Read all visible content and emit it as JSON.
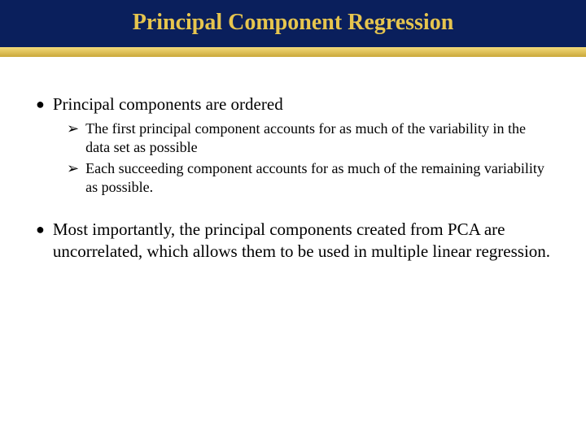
{
  "title": "Principal Component Regression",
  "bullets": {
    "b1": {
      "text": "Principal components are ordered",
      "sub1": "The first principal component accounts for as much of the variability in the data set as possible",
      "sub2": "Each succeeding component accounts for as much of the remaining variability as possible."
    },
    "b2": {
      "text": "Most importantly, the principal components created from PCA are uncorrelated, which allows them to be used in multiple linear regression."
    }
  },
  "glyphs": {
    "disc": "●",
    "arrow": "➢"
  }
}
